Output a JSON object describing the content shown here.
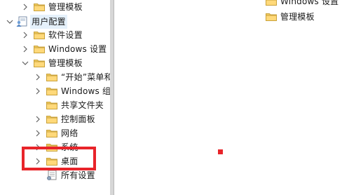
{
  "tree": {
    "items": [
      {
        "label": "管理模板",
        "state": "collapsed",
        "icon": "folder-icon"
      },
      {
        "label": "用户配置",
        "state": "expanded",
        "icon": "user-config-icon"
      },
      {
        "label": "软件设置",
        "state": "collapsed",
        "icon": "folder-icon"
      },
      {
        "label": "Windows 设置",
        "state": "collapsed",
        "icon": "folder-icon"
      },
      {
        "label": "管理模板",
        "state": "expanded",
        "icon": "folder-icon"
      },
      {
        "label": "“开始”菜单和",
        "state": "collapsed",
        "icon": "folder-icon"
      },
      {
        "label": "Windows 组",
        "state": "collapsed",
        "icon": "folder-icon"
      },
      {
        "label": "共享文件夹",
        "state": "leaf",
        "icon": "folder-icon"
      },
      {
        "label": "控制面板",
        "state": "collapsed",
        "icon": "folder-icon"
      },
      {
        "label": "网络",
        "state": "collapsed",
        "icon": "folder-icon"
      },
      {
        "label": "系统",
        "state": "collapsed",
        "icon": "folder-icon"
      },
      {
        "label": "桌面",
        "state": "collapsed",
        "icon": "folder-icon"
      },
      {
        "label": "所有设置",
        "state": "leaf",
        "icon": "settings-doc-icon"
      }
    ]
  },
  "detail": {
    "items": [
      {
        "label": "Windows 设置",
        "icon": "folder-icon"
      },
      {
        "label": "管理模板",
        "icon": "folder-icon"
      }
    ]
  },
  "colors": {
    "folder": "#e8c15a",
    "highlight": "#e8242a",
    "chevron": "#606060"
  }
}
